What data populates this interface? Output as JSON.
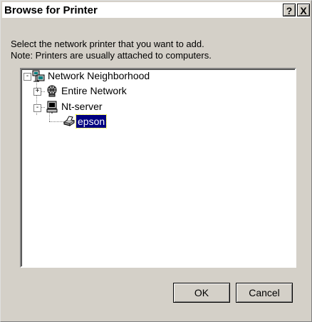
{
  "window": {
    "title": "Browse for Printer",
    "help_glyph": "?",
    "close_glyph": "X"
  },
  "description": {
    "line1": "Select the network printer that you want to add.",
    "line2": "Note: Printers are usually attached to computers."
  },
  "tree": {
    "items": [
      {
        "label": "Network Neighborhood",
        "icon": "network-neighborhood-icon",
        "expander": "-"
      },
      {
        "label": "Entire Network",
        "icon": "globe-icon",
        "expander": "+"
      },
      {
        "label": "Nt-server",
        "icon": "computer-icon",
        "expander": "-"
      },
      {
        "label": "epson",
        "icon": "printer-icon",
        "selected": true
      }
    ]
  },
  "buttons": {
    "ok": "OK",
    "cancel": "Cancel"
  },
  "colors": {
    "face": "#d4d0c8",
    "selection": "#000080"
  }
}
